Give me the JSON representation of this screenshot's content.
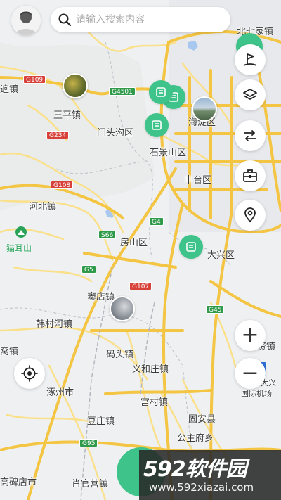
{
  "search": {
    "placeholder": "请输入搜索内容"
  },
  "places": {
    "beiqijia": "北七家镇",
    "wangpingzhen": "王平镇",
    "mentougou": "门头沟区",
    "haidian": "海淀区",
    "shijingshan": "石景山区",
    "fengtai": "丰台区",
    "hebeizhen": "河北镇",
    "maoershan": "猫耳山",
    "fangshan": "房山区",
    "daxing": "大兴区",
    "doudianzhen": "窦店镇",
    "hancunhe": "韩村河镇",
    "matouzhen": "码头镇",
    "yihezhuang": "义和庄镇",
    "zhuozhou": "涿州市",
    "gongcunzhen": "宫村镇",
    "douzhuang": "豆庄镇",
    "guan": "固安县",
    "gongzhufu": "公主府乡",
    "gaobeidian": "高碑店市",
    "xiaoguanying": "肖官营镇",
    "leftcut1": "逈镇",
    "leftcut2": "窝镇",
    "rightcut": "资镇",
    "airport_line1": "大兴",
    "airport_line2": "国际机场"
  },
  "road_badges": {
    "g109": "G109",
    "g4501": "G4501",
    "g234": "G234",
    "g108": "G108",
    "s66": "S66",
    "g4": "G4",
    "g5": "G5",
    "g107": "G107",
    "g45": "G45",
    "g95": "G95"
  },
  "zoom": {
    "in": "+",
    "out": "−"
  },
  "watermark": {
    "brand": "592软件园",
    "url": "www.592xiazai.com"
  },
  "icons": {
    "avatar": "user-avatar-icon",
    "search": "search-icon",
    "flag": "flag-landmark-icon",
    "layers": "layers-icon",
    "route": "route-icon",
    "toolbox": "toolbox-icon",
    "location_pin": "location-pin-icon",
    "locate": "locate-crosshair-icon",
    "note": "note-marker-icon"
  },
  "colors": {
    "accent": "#3ec48a",
    "road_major": "#f4c542",
    "road_minor": "#fbe08a",
    "map_bg": "#eef0f2"
  }
}
